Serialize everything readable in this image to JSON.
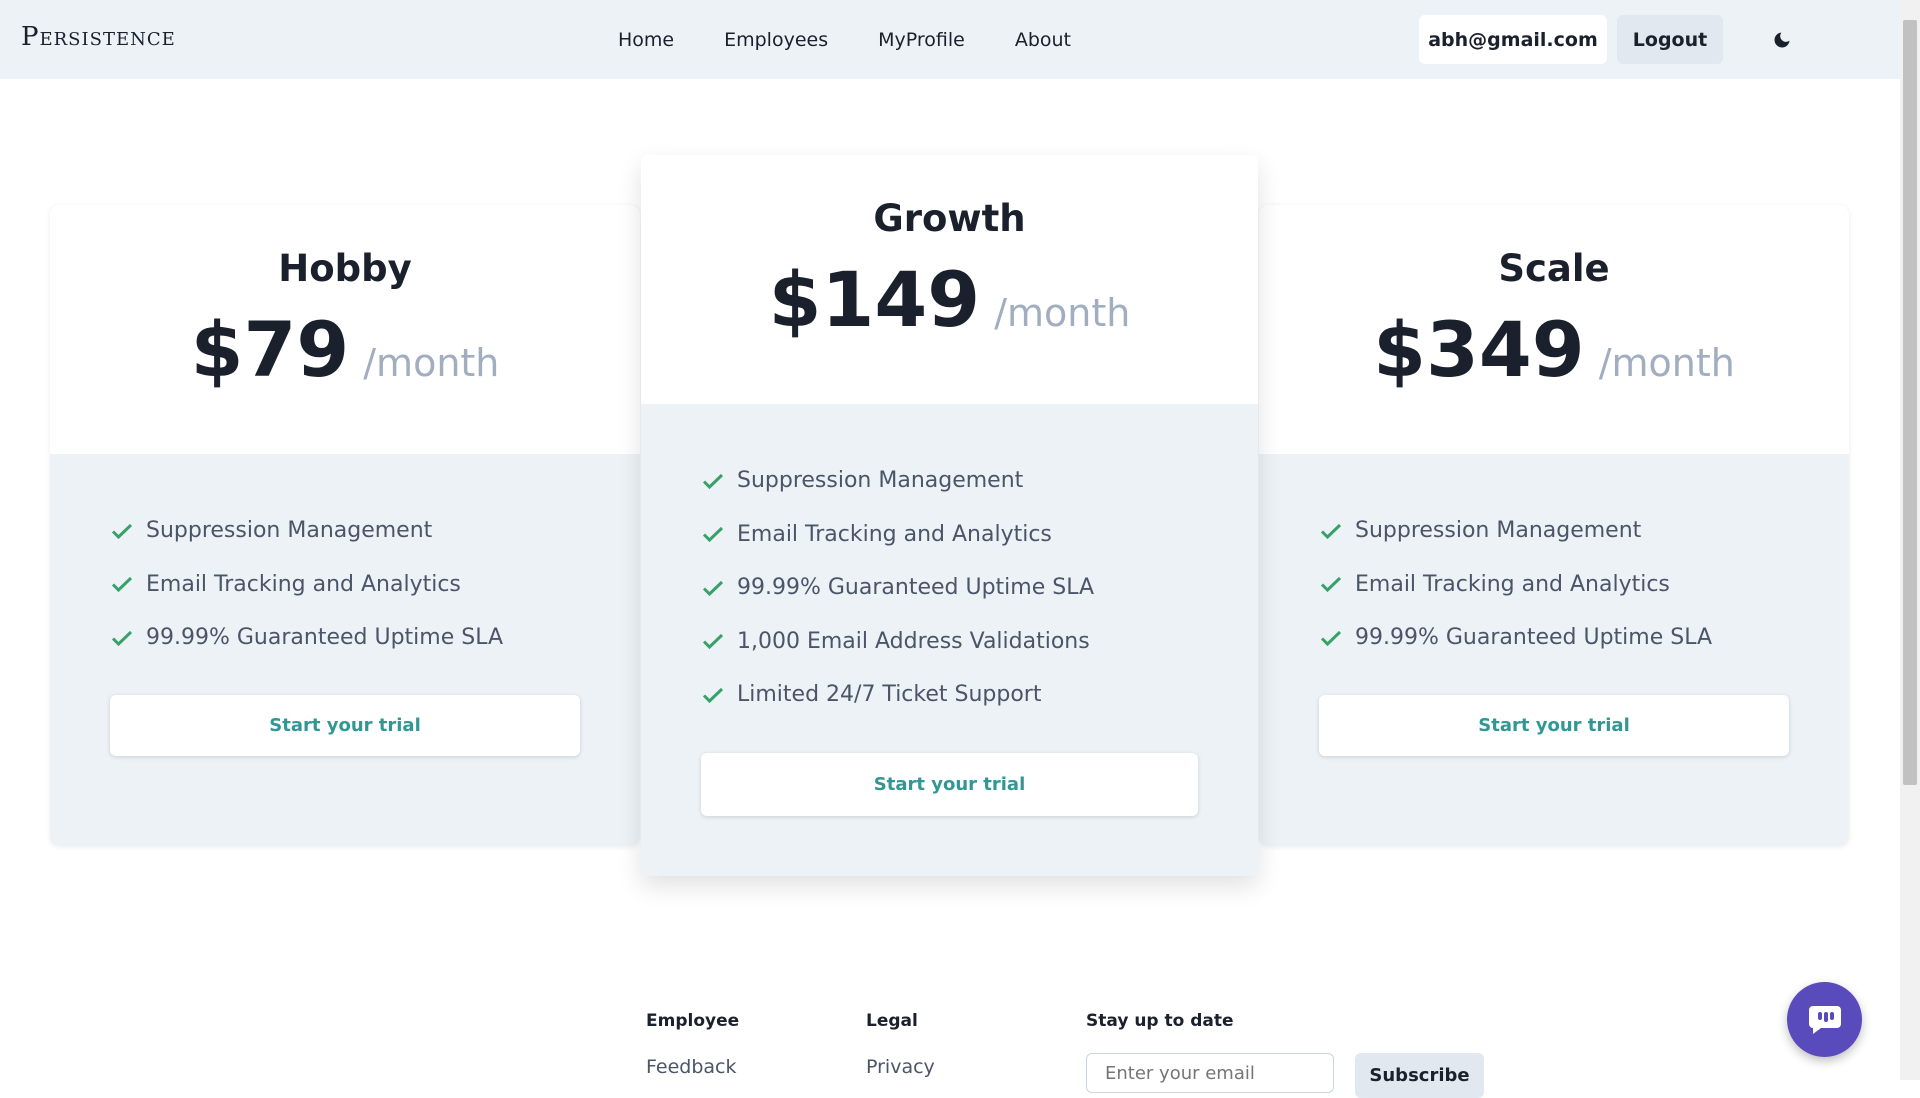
{
  "header": {
    "brand": "Persistence",
    "nav": [
      "Home",
      "Employees",
      "MyProfile",
      "About"
    ],
    "user_email": "abh@gmail.com",
    "logout_label": "Logout",
    "theme_icon": "moon-icon"
  },
  "plans": [
    {
      "name": "Hobby",
      "price": "$79",
      "period": "/month",
      "features": [
        "Suppression Management",
        "Email Tracking and Analytics",
        "99.99% Guaranteed Uptime SLA"
      ],
      "cta": "Start your trial"
    },
    {
      "name": "Growth",
      "price": "$149",
      "period": "/month",
      "features": [
        "Suppression Management",
        "Email Tracking and Analytics",
        "99.99% Guaranteed Uptime SLA",
        "1,000 Email Address Validations",
        "Limited 24/7 Ticket Support"
      ],
      "cta": "Start your trial"
    },
    {
      "name": "Scale",
      "price": "$349",
      "period": "/month",
      "features": [
        "Suppression Management",
        "Email Tracking and Analytics",
        "99.99% Guaranteed Uptime SLA"
      ],
      "cta": "Start your trial"
    }
  ],
  "footer": {
    "employee_heading": "Employee",
    "employee_link": "Feedback",
    "legal_heading": "Legal",
    "legal_link": "Privacy",
    "newsletter_heading": "Stay up to date",
    "email_placeholder": "Enter your email",
    "subscribe_label": "Subscribe"
  },
  "colors": {
    "accent": "#319795",
    "check": "#38a169",
    "chat_fab": "#5a4bbd",
    "nav_bg": "#edf2f7"
  }
}
